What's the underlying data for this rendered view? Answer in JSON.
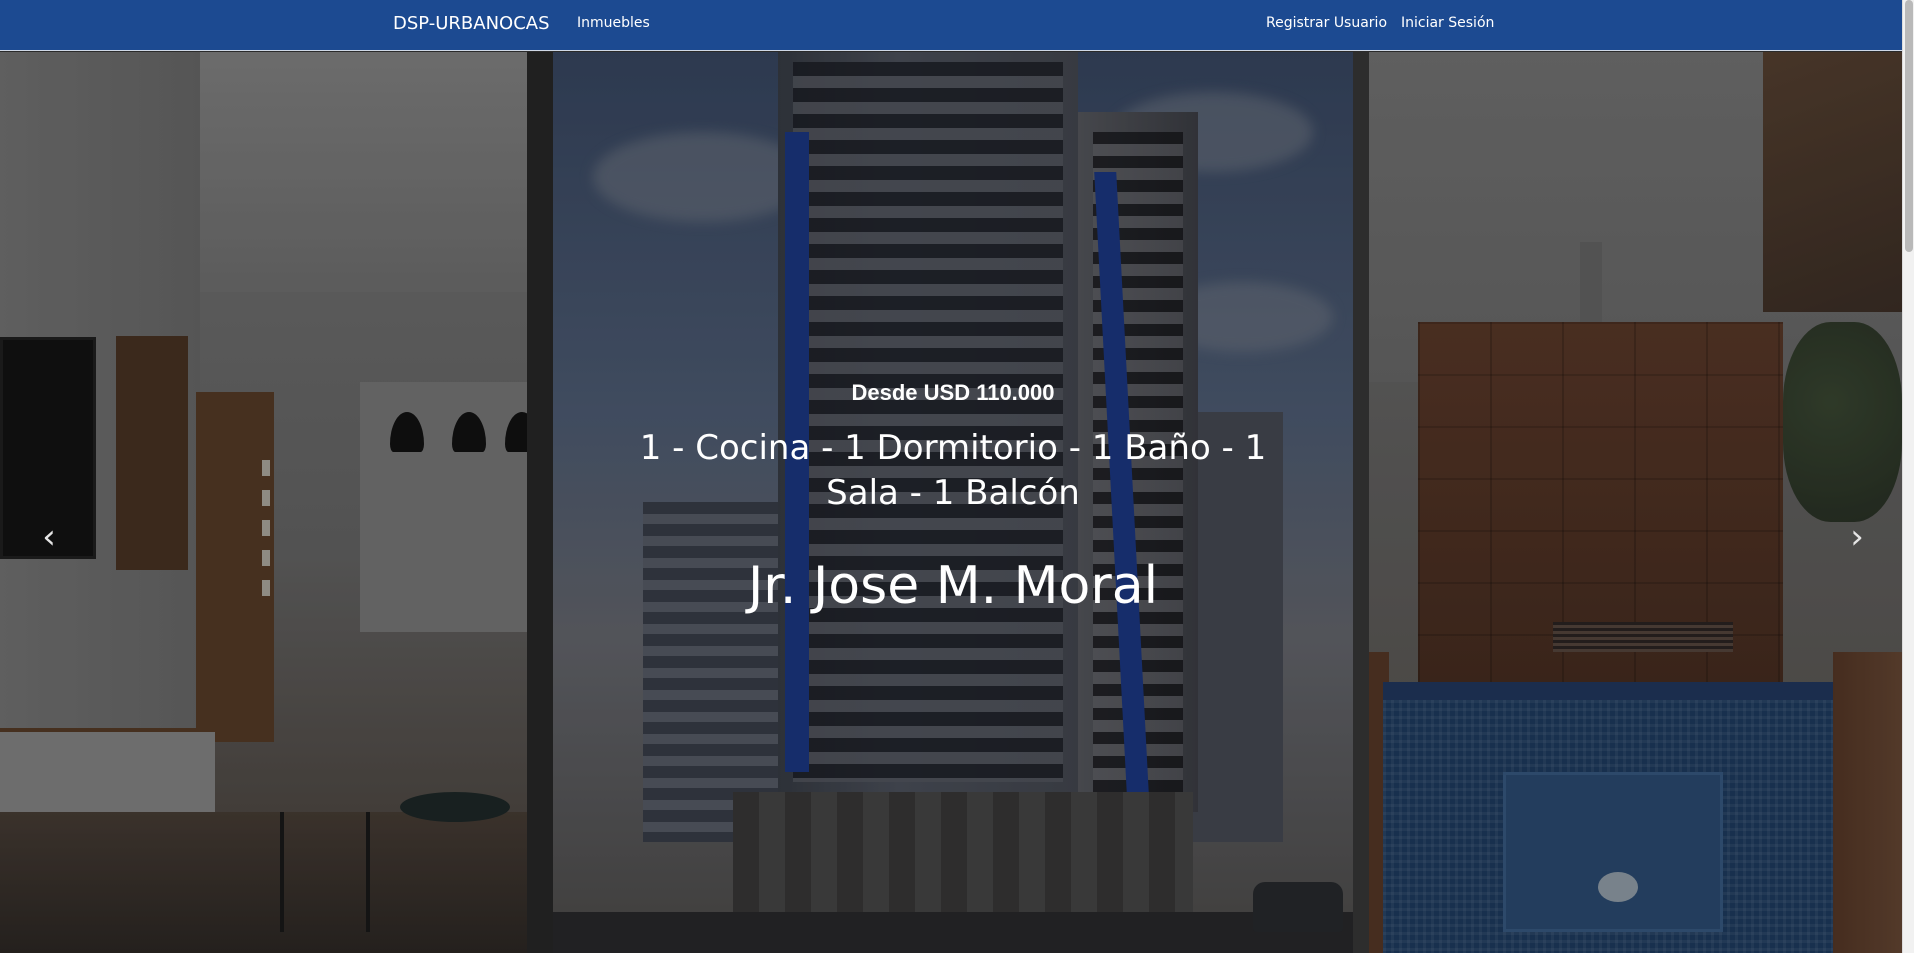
{
  "navbar": {
    "brand": "DSP-URBANOCAS",
    "links": {
      "inmuebles": "Inmuebles",
      "register": "Registrar Usuario",
      "login": "Iniciar Sesión"
    },
    "background_color": "#1c4a91"
  },
  "carousel": {
    "caption": {
      "price": "Desde USD 110.000",
      "features": "1 - Cocina - 1 Dormitorio - 1 Baño - 1 Sala - 1 Balcón",
      "address": "Jr. Jose M. Moral"
    },
    "controls": {
      "prev_icon": "chevron-left-icon",
      "next_icon": "chevron-right-icon",
      "prev_glyph": "‹",
      "next_glyph": "›"
    },
    "slides": [
      {
        "image": "living-room"
      },
      {
        "image": "apartment-building"
      },
      {
        "image": "rooftop-pool"
      }
    ]
  }
}
